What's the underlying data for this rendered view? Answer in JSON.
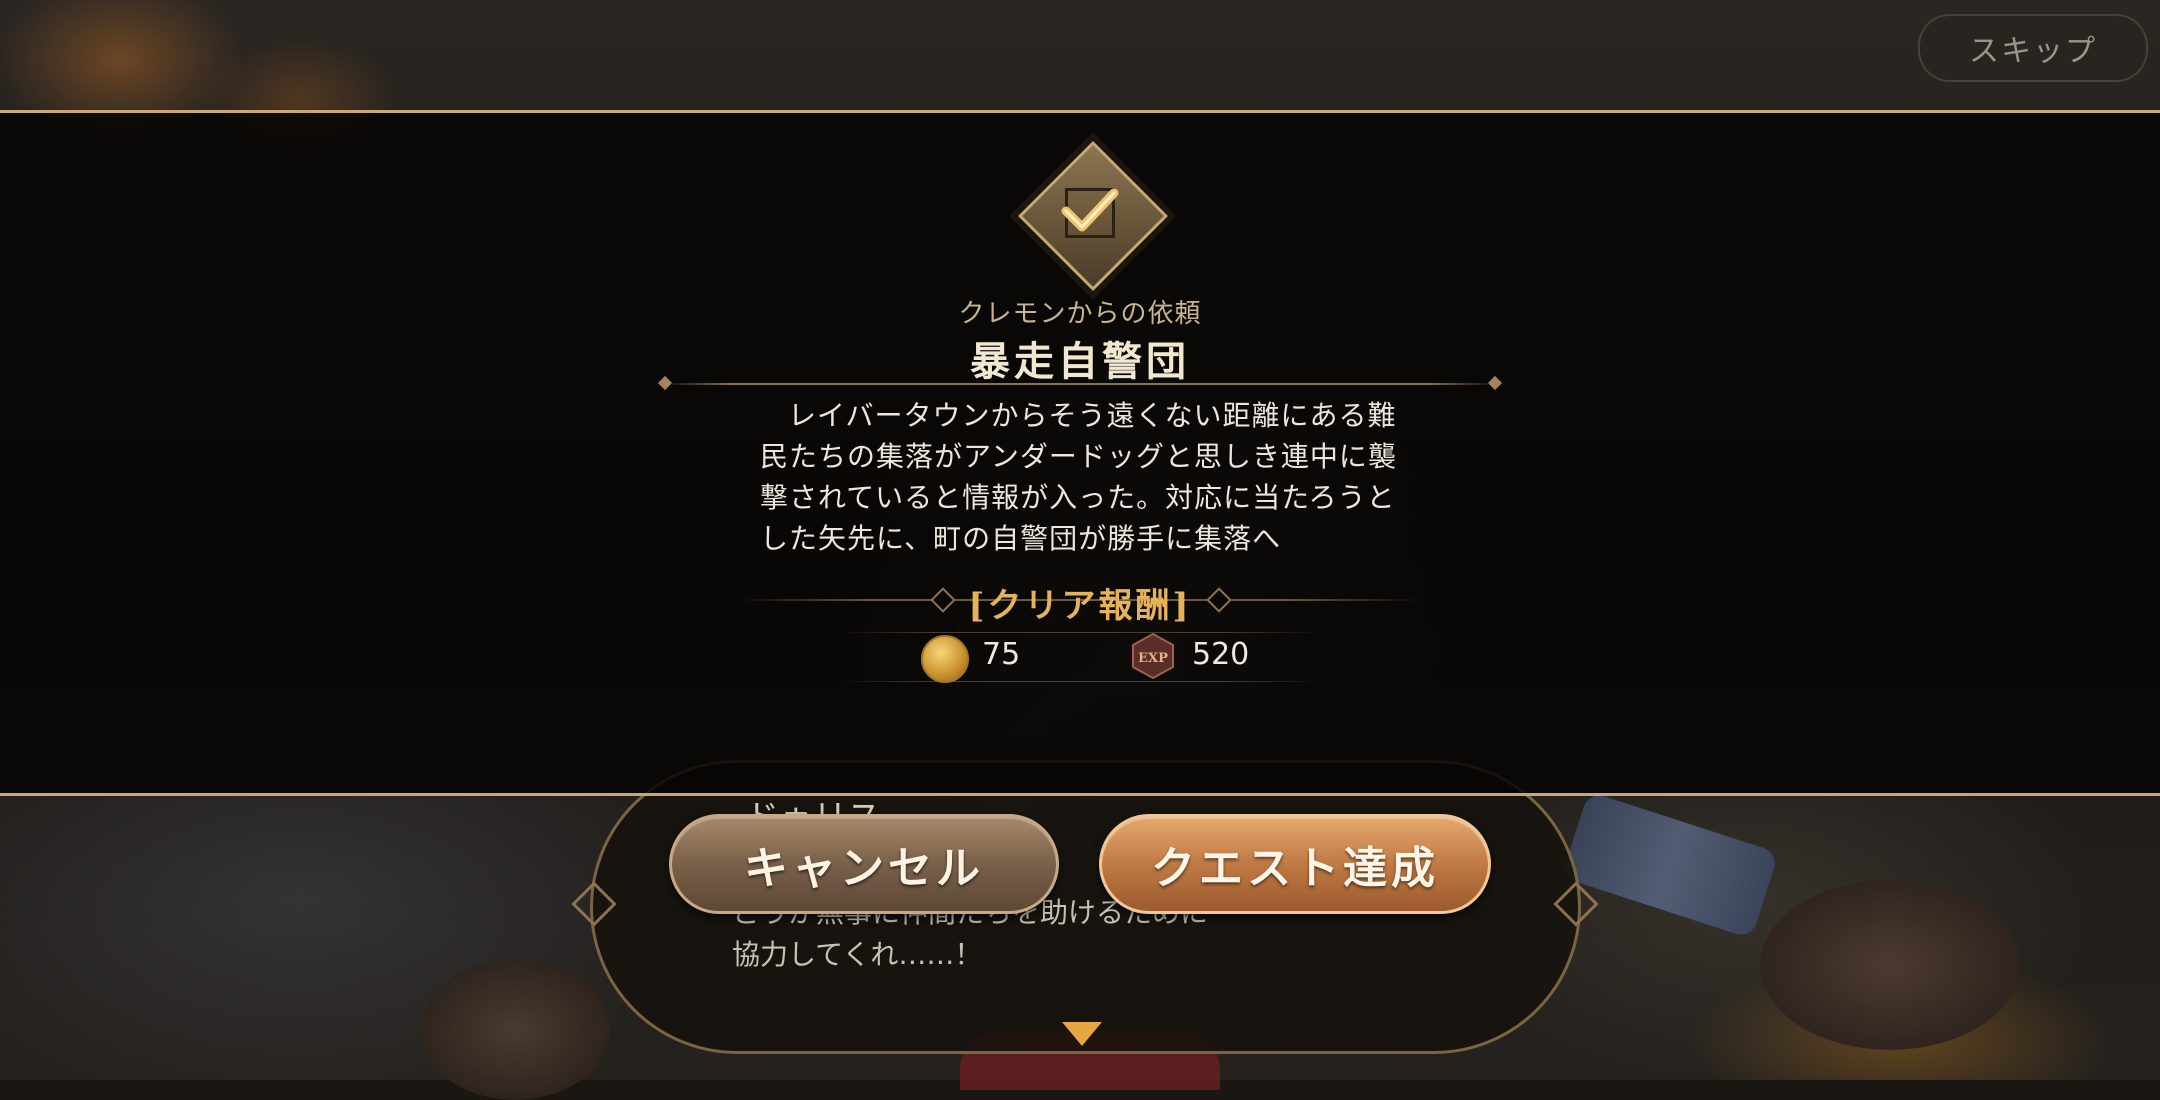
{
  "skip_label": "スキップ",
  "dialog": {
    "speaker": "ドゥリス",
    "text": "……を\nどうか無事に仲間たちを助けるために\n協力してくれ……！"
  },
  "quest": {
    "subtitle": "クレモンからの依頼",
    "title": "暴走自警団",
    "description": "レイバータウンからそう遠くない距離にある難民たちの集落がアンダードッグと思しき連中に襲撃されていると情報が入った。対応に当たろうとした矢先に、町の自警団が勝手に集落へ",
    "reward_header": "[クリア報酬]",
    "rewards": {
      "coin_value": "75",
      "exp_label": "EXP",
      "exp_value": "520"
    }
  },
  "buttons": {
    "cancel_label": "キャンセル",
    "complete_label": "クエスト達成"
  },
  "colors": {
    "accent_gold": "#c9a876",
    "reward_header": "#e6b25a",
    "complete_button": "#c07a44",
    "next_arrow": "#e7a544"
  }
}
